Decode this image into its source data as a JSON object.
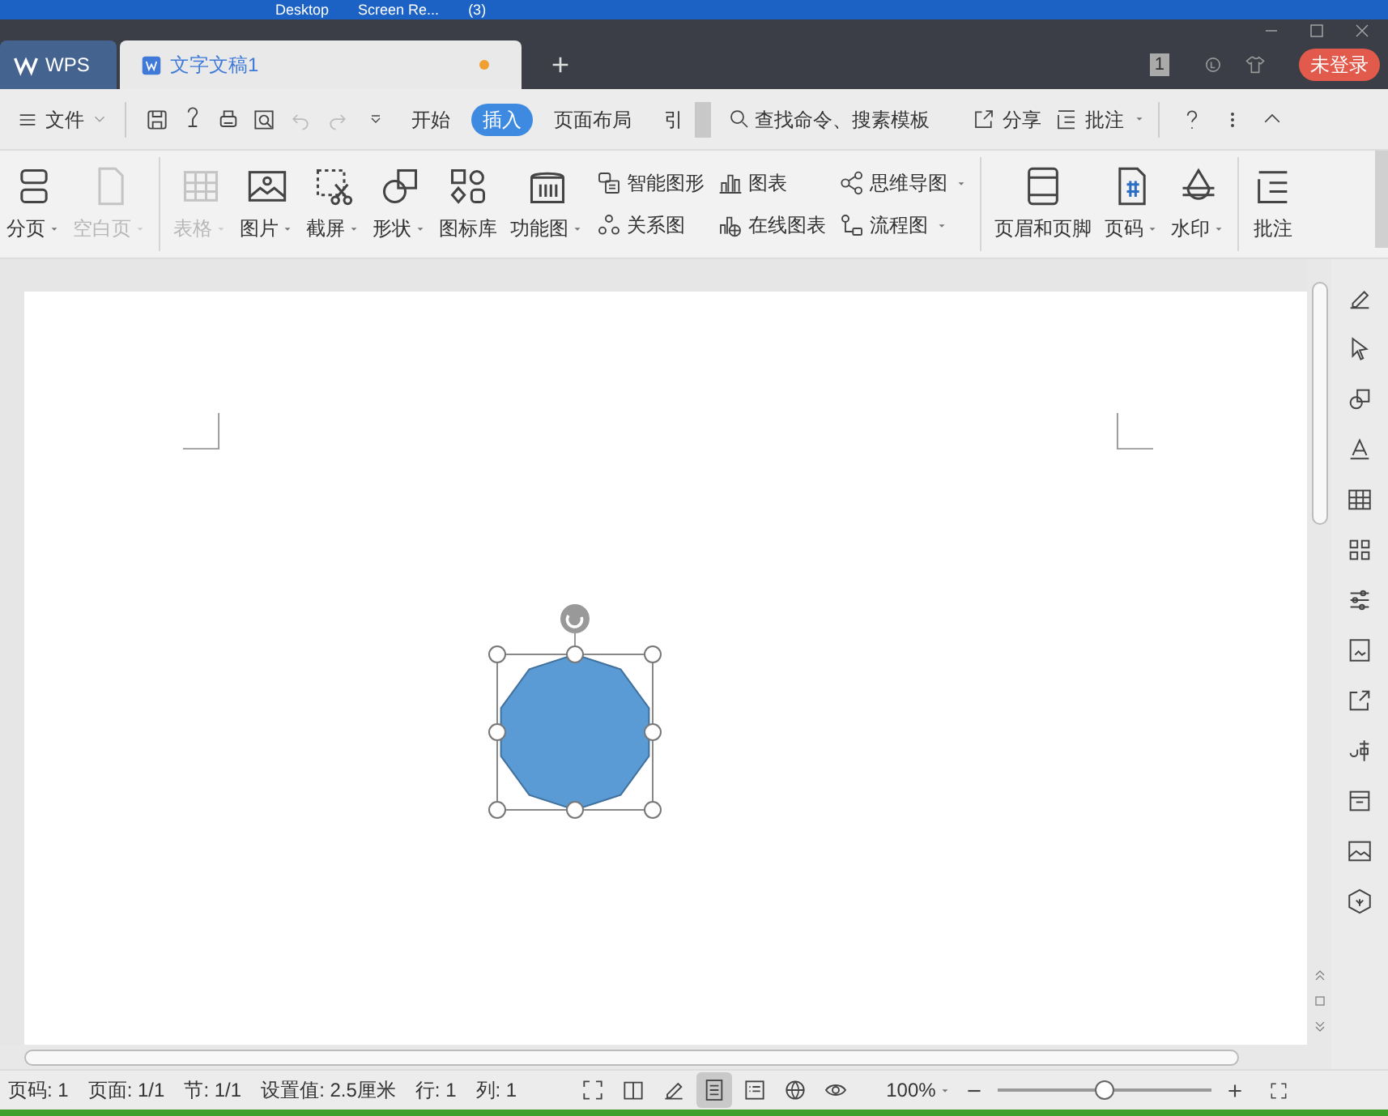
{
  "taskbar": [
    "Desktop",
    "Screen Re...",
    "(3)"
  ],
  "tabs": [
    {
      "label": "WPS",
      "selected": false
    },
    {
      "label": "文字文稿1",
      "selected": true,
      "modified": true
    }
  ],
  "page_count_badge": "1",
  "login_button": "未登录",
  "menu": {
    "file": "文件",
    "tabs": [
      {
        "label": "开始",
        "selected": false
      },
      {
        "label": "插入",
        "selected": true
      },
      {
        "label": "页面布局",
        "selected": false
      },
      {
        "label": "引",
        "selected": false
      }
    ],
    "search": "查找命令、搜素模板",
    "share": "分享",
    "comment": "批注"
  },
  "ribbon": [
    {
      "kind": "big",
      "label": "分页",
      "dropdown": true,
      "disabled": false
    },
    {
      "kind": "big",
      "label": "空白页",
      "dropdown": true,
      "disabled": true
    },
    {
      "kind": "sep"
    },
    {
      "kind": "big",
      "label": "表格",
      "dropdown": true,
      "disabled": true
    },
    {
      "kind": "big",
      "label": "图片",
      "dropdown": true,
      "disabled": false
    },
    {
      "kind": "big",
      "label": "截屏",
      "dropdown": true,
      "disabled": false
    },
    {
      "kind": "big",
      "label": "形状",
      "dropdown": true,
      "disabled": false
    },
    {
      "kind": "big",
      "label": "图标库",
      "dropdown": false,
      "disabled": false
    },
    {
      "kind": "big",
      "label": "功能图",
      "dropdown": true,
      "disabled": false
    },
    {
      "kind": "small",
      "items": [
        {
          "label": "智能图形",
          "dropdown": false
        },
        {
          "label": "关系图",
          "dropdown": false
        }
      ]
    },
    {
      "kind": "small",
      "items": [
        {
          "label": "图表",
          "dropdown": false
        },
        {
          "label": "在线图表",
          "dropdown": false
        }
      ]
    },
    {
      "kind": "small",
      "items": [
        {
          "label": "思维导图",
          "dropdown": true
        },
        {
          "label": "流程图",
          "dropdown": true
        }
      ]
    },
    {
      "kind": "sep"
    },
    {
      "kind": "big",
      "label": "页眉和页脚",
      "dropdown": false,
      "disabled": false
    },
    {
      "kind": "big",
      "label": "页码",
      "dropdown": true,
      "disabled": false
    },
    {
      "kind": "big",
      "label": "水印",
      "dropdown": true,
      "disabled": false
    },
    {
      "kind": "sep"
    },
    {
      "kind": "big",
      "label": "批注",
      "dropdown": false,
      "disabled": false
    }
  ],
  "status_bar": {
    "items": [
      "页码: 1",
      "页面: 1/1",
      "节: 1/1",
      "设置值: 2.5厘米",
      "行: 1",
      "列: 1"
    ],
    "views": [
      {
        "selected": false
      },
      {
        "selected": false
      },
      {
        "selected": false
      },
      {
        "selected": true
      },
      {
        "selected": false
      },
      {
        "selected": false
      },
      {
        "selected": false
      }
    ],
    "zoom": "100%",
    "zoom_slider": {
      "level": 0.5
    }
  }
}
